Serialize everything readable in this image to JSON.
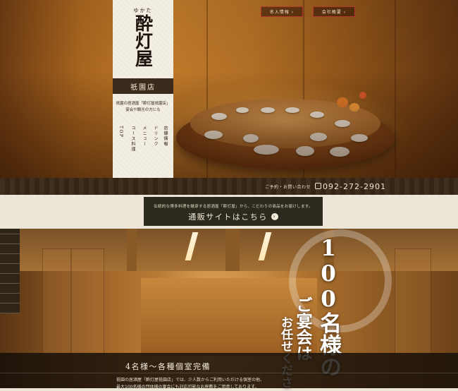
{
  "header": {
    "buttons": [
      {
        "label": "名入情報 ›"
      },
      {
        "label": "会社概要 ›"
      }
    ]
  },
  "logo": {
    "kana": "ゆかた",
    "name": "酔灯屋",
    "branch": "祇園店",
    "description_line1": "祇園の居酒屋「酔灯屋祇園店」",
    "description_line2": "宴会や観光の方にも"
  },
  "nav": {
    "items": [
      "TOP",
      "コース料理",
      "メニュー",
      "ドリンク",
      "店舗情報"
    ]
  },
  "contact": {
    "label": "ご予約・お問い合わせ",
    "phone": "092-272-2901"
  },
  "banner": {
    "subtitle": "伝統的な博多料理を継承する居酒屋「酔灯屋」から、こだわりの商品をお届けします。",
    "title": "通販サイトはこちら",
    "arrow": "›"
  },
  "hero_section": {
    "vertical_line1": "100名様の",
    "vertical_line2": "ご宴会は",
    "vertical_line3": "お任せくださ"
  },
  "caption": {
    "title": "4名様～各種個室完備",
    "text_line1": "祇園の居酒屋「酔灯屋祇園店」では、少人数からご利用いただける個室の他、",
    "text_line2": "最大100名様の団体様の宴会にも対応可能なお座敷をご用意しております。"
  },
  "colors": {
    "accent_red": "#b3382a",
    "banner_bg": "#2c2a1e",
    "panel_bg": "#f4efe4"
  }
}
